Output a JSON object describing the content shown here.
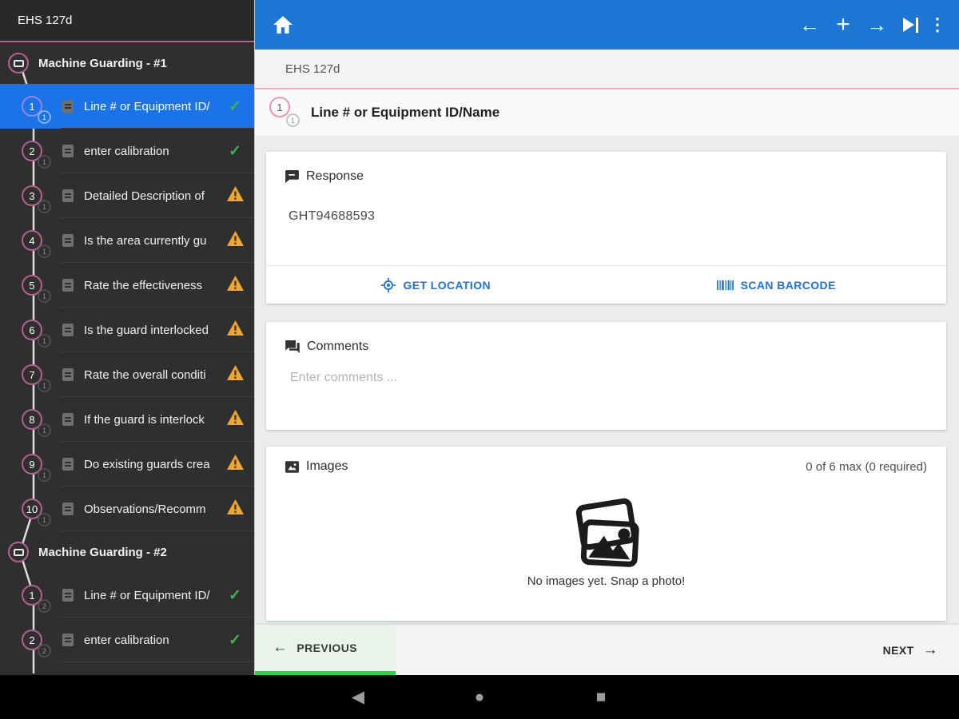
{
  "colors": {
    "app_bar": "#1c76d3",
    "selected": "#1a73e8",
    "pink": "#b85f92",
    "pink_light": "#f2a9c6",
    "green": "#3cb54a",
    "warning": "#f0a732",
    "footer_green": "#30d14a",
    "blue_accent": "#1a73e8"
  },
  "icons": {
    "check": "✓",
    "back": "←",
    "add": "+",
    "forward": "→",
    "overflow": "⋮",
    "prev_arrow": "←",
    "next_arrow": "→",
    "android_back": "◀",
    "android_home": "●",
    "android_recents": "■"
  },
  "sidebar": {
    "title": "EHS 127d",
    "sections": [
      {
        "label": "Machine Guarding - #1",
        "items": [
          {
            "num": "1",
            "sub": "1",
            "label": "Line # or Equipment ID/",
            "status": "check",
            "selected": true
          },
          {
            "num": "2",
            "sub": "1",
            "label": "enter calibration",
            "status": "check"
          },
          {
            "num": "3",
            "sub": "1",
            "label": "Detailed Description of",
            "status": "warning"
          },
          {
            "num": "4",
            "sub": "1",
            "label": "Is the area currently gu",
            "status": "warning"
          },
          {
            "num": "5",
            "sub": "1",
            "label": "Rate the effectiveness",
            "status": "warning"
          },
          {
            "num": "6",
            "sub": "1",
            "label": "Is the guard interlocked",
            "status": "warning"
          },
          {
            "num": "7",
            "sub": "1",
            "label": "Rate the overall conditi",
            "status": "warning"
          },
          {
            "num": "8",
            "sub": "1",
            "label": "If the guard is interlock",
            "status": "warning"
          },
          {
            "num": "9",
            "sub": "1",
            "label": "Do existing guards crea",
            "status": "warning"
          },
          {
            "num": "10",
            "sub": "1",
            "label": "Observations/Recomm",
            "status": "warning"
          }
        ]
      },
      {
        "label": "Machine Guarding - #2",
        "items": [
          {
            "num": "1",
            "sub": "2",
            "label": "Line # or Equipment ID/",
            "status": "check"
          },
          {
            "num": "2",
            "sub": "2",
            "label": "enter calibration",
            "status": "check"
          }
        ]
      }
    ]
  },
  "breadcrumb": "EHS 127d",
  "question": {
    "num": "1",
    "sub": "1",
    "title": "Line # or Equipment ID/Name"
  },
  "response": {
    "label": "Response",
    "value": "GHT94688593",
    "get_location": "GET LOCATION",
    "scan_barcode": "SCAN BARCODE"
  },
  "comments": {
    "label": "Comments",
    "placeholder": "Enter comments ..."
  },
  "images": {
    "label": "Images",
    "counter": "0 of 6 max (0 required)",
    "empty_text": "No images yet. Snap a photo!"
  },
  "footer": {
    "previous": "PREVIOUS",
    "next": "NEXT"
  }
}
